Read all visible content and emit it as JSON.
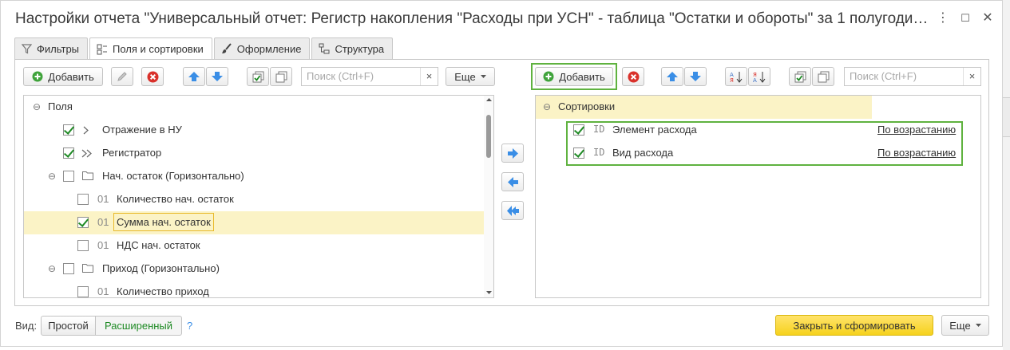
{
  "window": {
    "title": "Настройки отчета \"Универсальный отчет: Регистр накопления \"Расходы при УСН\" - таблица \"Остатки и обороты\" за 1 полугоди…",
    "more_icon": "⋮",
    "maximize_icon": "☐",
    "close_icon": "✕"
  },
  "tabs": [
    {
      "label": "Фильтры",
      "icon": "filter-icon"
    },
    {
      "label": "Поля и сортировки",
      "icon": "fields-icon"
    },
    {
      "label": "Оформление",
      "icon": "brush-icon"
    },
    {
      "label": "Структура",
      "icon": "structure-icon"
    }
  ],
  "left_toolbar": {
    "add_label": "Добавить",
    "search_placeholder": "Поиск (Ctrl+F)",
    "search_clear": "×",
    "more_label": "Еще"
  },
  "right_toolbar": {
    "add_label": "Добавить",
    "search_placeholder": "Поиск (Ctrl+F)",
    "search_clear": "×"
  },
  "fields_tree": {
    "root": "Поля",
    "items": [
      {
        "label": "Отражение в НУ",
        "checked": true,
        "prefix": ">"
      },
      {
        "label": "Регистратор",
        "checked": true,
        "prefix": ">>"
      },
      {
        "label": "Нач. остаток (Горизонтально)",
        "checked": false,
        "prefix": "folder"
      },
      {
        "label": "Количество нач. остаток",
        "checked": false,
        "prefix": "01"
      },
      {
        "label": "Сумма нач. остаток",
        "checked": true,
        "prefix": "01"
      },
      {
        "label": "НДС нач. остаток",
        "checked": false,
        "prefix": "01"
      },
      {
        "label": "Приход (Горизонтально)",
        "checked": false,
        "prefix": "folder"
      },
      {
        "label": "Количество приход",
        "checked": false,
        "prefix": "01"
      }
    ]
  },
  "sort_tree": {
    "root": "Сортировки",
    "items": [
      {
        "label": "Элемент расхода",
        "prefix": "ID",
        "direction": "По возрастанию",
        "checked": true
      },
      {
        "label": "Вид расхода",
        "prefix": "ID",
        "direction": "По возрастанию",
        "checked": true
      }
    ]
  },
  "footer": {
    "view_label": "Вид:",
    "view_simple": "Простой",
    "view_extended": "Расширенный",
    "help": "?",
    "close_and_build": "Закрыть и сформировать",
    "more_label": "Еще"
  },
  "colors": {
    "accent_green": "#5fb23f",
    "primary_yellow": "#f6d21d",
    "selection": "#fbf3c6",
    "delete_red": "#d9312b",
    "arrow_blue": "#3a8ee6"
  }
}
